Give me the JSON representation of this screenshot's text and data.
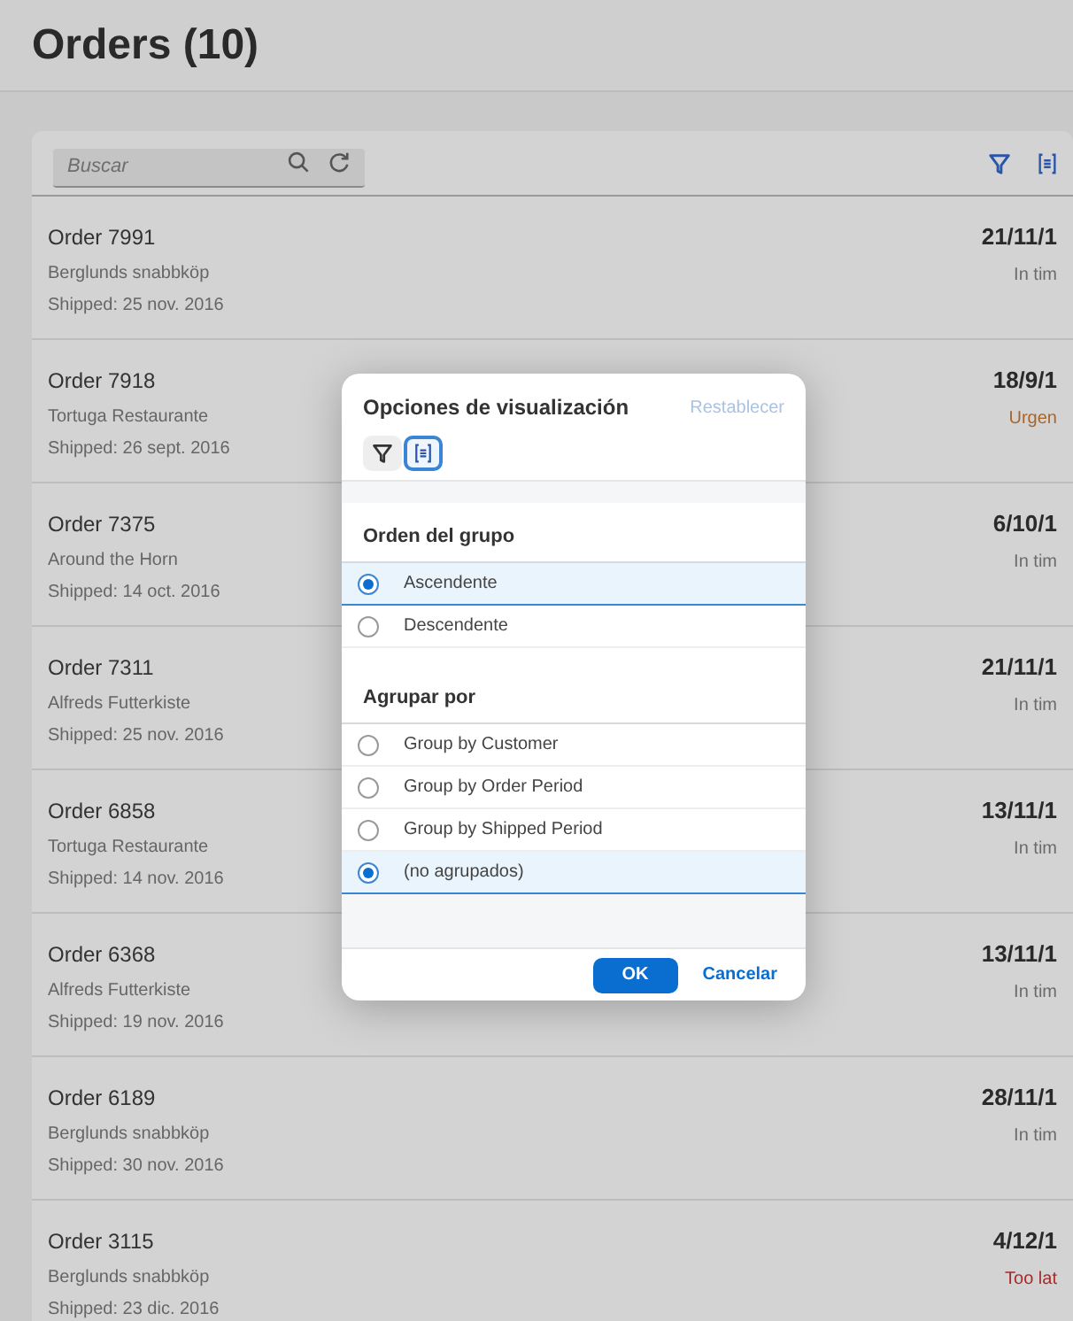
{
  "page": {
    "title": "Orders (10)"
  },
  "toolbar": {
    "search": {
      "placeholder": "Buscar"
    }
  },
  "orders": [
    {
      "title": "Order 7991",
      "customer": "Berglunds snabbköp",
      "shipped": "Shipped: 25 nov. 2016",
      "date": "21/11/1",
      "status": "In tim",
      "color": "#6b6b6b"
    },
    {
      "title": "Order 7918",
      "customer": "Tortuga Restaurante",
      "shipped": "Shipped: 26 sept. 2016",
      "date": "18/9/1",
      "status": "Urgen",
      "color": "#a8652a"
    },
    {
      "title": "Order 7375",
      "customer": "Around the Horn",
      "shipped": "Shipped: 14 oct. 2016",
      "date": "6/10/1",
      "status": "In tim",
      "color": "#6b6b6b"
    },
    {
      "title": "Order 7311",
      "customer": "Alfreds Futterkiste",
      "shipped": "Shipped: 25 nov. 2016",
      "date": "21/11/1",
      "status": "In tim",
      "color": "#6b6b6b"
    },
    {
      "title": "Order 6858",
      "customer": "Tortuga Restaurante",
      "shipped": "Shipped: 14 nov. 2016",
      "date": "13/11/1",
      "status": "In tim",
      "color": "#6b6b6b"
    },
    {
      "title": "Order 6368",
      "customer": "Alfreds Futterkiste",
      "shipped": "Shipped: 19 nov. 2016",
      "date": "13/11/1",
      "status": "In tim",
      "color": "#6b6b6b"
    },
    {
      "title": "Order 6189",
      "customer": "Berglunds snabbköp",
      "shipped": "Shipped: 30 nov. 2016",
      "date": "28/11/1",
      "status": "In tim",
      "color": "#6b6b6b"
    },
    {
      "title": "Order 3115",
      "customer": "Berglunds snabbköp",
      "shipped": "Shipped: 23 dic. 2016",
      "date": "4/12/1",
      "status": "Too lat",
      "color": "#a82a2a"
    }
  ],
  "dialog": {
    "title": "Opciones de visualización",
    "reset": {
      "label": "Restablecer",
      "disabled": true
    },
    "modes": [
      {
        "kind": "filter",
        "selected": false
      },
      {
        "kind": "group",
        "selected": true
      }
    ],
    "sections": [
      {
        "title": "Orden del grupo",
        "options": [
          {
            "label": "Ascendente",
            "selected": true
          },
          {
            "label": "Descendente",
            "selected": false
          }
        ]
      },
      {
        "title": "Agrupar por",
        "options": [
          {
            "label": "Group by Customer",
            "selected": false
          },
          {
            "label": "Group by Order Period",
            "selected": false
          },
          {
            "label": "Group by Shipped Period",
            "selected": false
          },
          {
            "label": "(no agrupados)",
            "selected": true
          }
        ]
      }
    ],
    "ok": "OK",
    "cancel": "Cancelar"
  }
}
